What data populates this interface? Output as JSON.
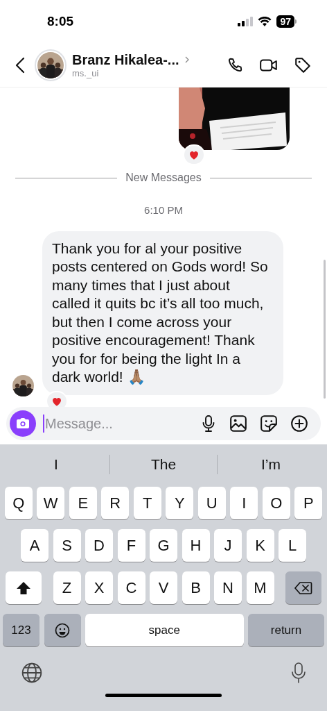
{
  "status_bar": {
    "time": "8:05",
    "battery": "97"
  },
  "header": {
    "name": "Branz Hikalea-...",
    "username": "ms._ui"
  },
  "chat": [
    {
      "kind": "story",
      "reaction": true
    },
    {
      "kind": "divider",
      "text": "New Messages"
    },
    {
      "kind": "timestamp",
      "text": "6:10 PM"
    },
    {
      "kind": "message",
      "text": "Thank you for al your positive posts centered on Gods word! So many times that I just about called it quits bc it’s all too much, but then I come across your positive encouragement! Thank you for for being the light In a dark world! 🙏🏽",
      "reaction": true
    }
  ],
  "composer": {
    "placeholder": "Message..."
  },
  "keyboard": {
    "suggestions": [
      "I",
      "The",
      "I’m"
    ],
    "rows": [
      [
        {
          "kind": "letter",
          "label": "Q"
        },
        {
          "kind": "letter",
          "label": "W"
        },
        {
          "kind": "letter",
          "label": "E"
        },
        {
          "kind": "letter",
          "label": "R"
        },
        {
          "kind": "letter",
          "label": "T"
        },
        {
          "kind": "letter",
          "label": "Y"
        },
        {
          "kind": "letter",
          "label": "U"
        },
        {
          "kind": "letter",
          "label": "I"
        },
        {
          "kind": "letter",
          "label": "O"
        },
        {
          "kind": "letter",
          "label": "P"
        }
      ],
      [
        {
          "kind": "letter",
          "label": "A"
        },
        {
          "kind": "letter",
          "label": "S"
        },
        {
          "kind": "letter",
          "label": "D"
        },
        {
          "kind": "letter",
          "label": "F"
        },
        {
          "kind": "letter",
          "label": "G"
        },
        {
          "kind": "letter",
          "label": "H"
        },
        {
          "kind": "letter",
          "label": "J"
        },
        {
          "kind": "letter",
          "label": "K"
        },
        {
          "kind": "letter",
          "label": "L"
        }
      ],
      [
        {
          "kind": "shift"
        },
        {
          "kind": "letter",
          "label": "Z"
        },
        {
          "kind": "letter",
          "label": "X"
        },
        {
          "kind": "letter",
          "label": "C"
        },
        {
          "kind": "letter",
          "label": "V"
        },
        {
          "kind": "letter",
          "label": "B"
        },
        {
          "kind": "letter",
          "label": "N"
        },
        {
          "kind": "letter",
          "label": "M"
        },
        {
          "kind": "backspace"
        }
      ]
    ],
    "bottom_row": {
      "numbers_key": "123",
      "space_key": "space",
      "return_key": "return"
    }
  }
}
